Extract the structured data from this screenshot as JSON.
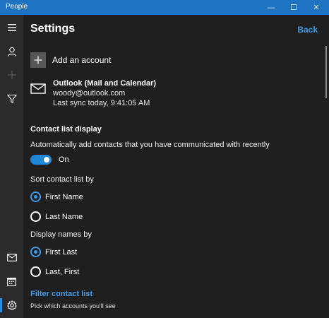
{
  "window": {
    "title": "People",
    "minimize": "—",
    "maximize": "☐",
    "close": "✕"
  },
  "rail": {
    "items": [
      {
        "name": "hamburger-icon"
      },
      {
        "name": "person-icon"
      },
      {
        "name": "add-icon"
      },
      {
        "name": "filter-icon"
      },
      {
        "name": "mail-icon"
      },
      {
        "name": "calendar-icon"
      },
      {
        "name": "gear-icon"
      }
    ]
  },
  "header": {
    "title": "Settings",
    "back_label": "Back"
  },
  "add_account": {
    "label": "Add an account"
  },
  "account": {
    "name": "Outlook (Mail and Calendar)",
    "email": "woody@outlook.com",
    "last_sync": "Last sync today, 9:41:05 AM"
  },
  "contact_display": {
    "heading": "Contact list display",
    "auto_add_text": "Automatically add contacts that you have communicated with recently",
    "toggle_state": "On",
    "sort_heading": "Sort contact list by",
    "sort_options": [
      "First Name",
      "Last Name"
    ],
    "sort_selected": "First Name",
    "display_heading": "Display names by",
    "display_options": [
      "First Last",
      "Last, First"
    ],
    "display_selected": "First Last"
  },
  "filter": {
    "link_label": "Filter contact list",
    "hint": "Pick which accounts you'll see"
  },
  "colors": {
    "accent": "#1e73c3",
    "link": "#3b9ae8",
    "background": "#1f1f1f",
    "rail": "#2b2b2b"
  }
}
